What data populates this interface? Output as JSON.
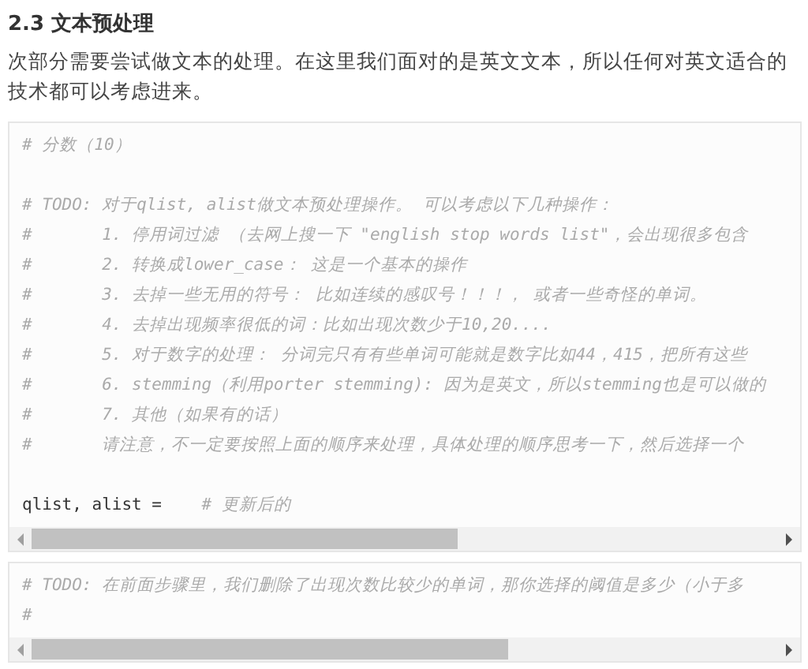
{
  "heading": "2.3 文本预处理",
  "paragraph": "次部分需要尝试做文本的处理。在这里我们面对的是英文文本，所以任何对英文适合的技术都可以考虑进来。",
  "cells": [
    {
      "lines": [
        {
          "kind": "comment",
          "comment": "# 分数（10）"
        },
        {
          "kind": "blank"
        },
        {
          "kind": "comment",
          "comment": "# TODO: 对于qlist, alist做文本预处理操作。 可以考虑以下几种操作："
        },
        {
          "kind": "comment",
          "comment": "#       1. 停用词过滤 （去网上搜一下 \"english stop words list\"，会出现很多包含"
        },
        {
          "kind": "comment",
          "comment": "#       2. 转换成lower_case： 这是一个基本的操作"
        },
        {
          "kind": "comment",
          "comment": "#       3. 去掉一些无用的符号： 比如连续的感叹号！！！， 或者一些奇怪的单词。"
        },
        {
          "kind": "comment",
          "comment": "#       4. 去掉出现频率很低的词：比如出现次数少于10,20...."
        },
        {
          "kind": "comment",
          "comment": "#       5. 对于数字的处理： 分词完只有有些单词可能就是数字比如44，415，把所有这些"
        },
        {
          "kind": "comment",
          "comment": "#       6. stemming（利用porter stemming): 因为是英文，所以stemming也是可以做的"
        },
        {
          "kind": "comment",
          "comment": "#       7. 其他（如果有的话）"
        },
        {
          "kind": "comment",
          "comment": "#       请注意，不一定要按照上面的顺序来处理，具体处理的顺序思考一下，然后选择一个"
        },
        {
          "kind": "blank"
        },
        {
          "kind": "code",
          "code": "qlist, alist =    ",
          "comment": "# 更新后的"
        }
      ]
    },
    {
      "lines": [
        {
          "kind": "comment",
          "comment": "# TODO: 在前面步骤里，我们删除了出现次数比较少的单词，那你选择的阈值是多少（小于多"
        },
        {
          "kind": "comment",
          "comment": "#"
        }
      ]
    }
  ]
}
